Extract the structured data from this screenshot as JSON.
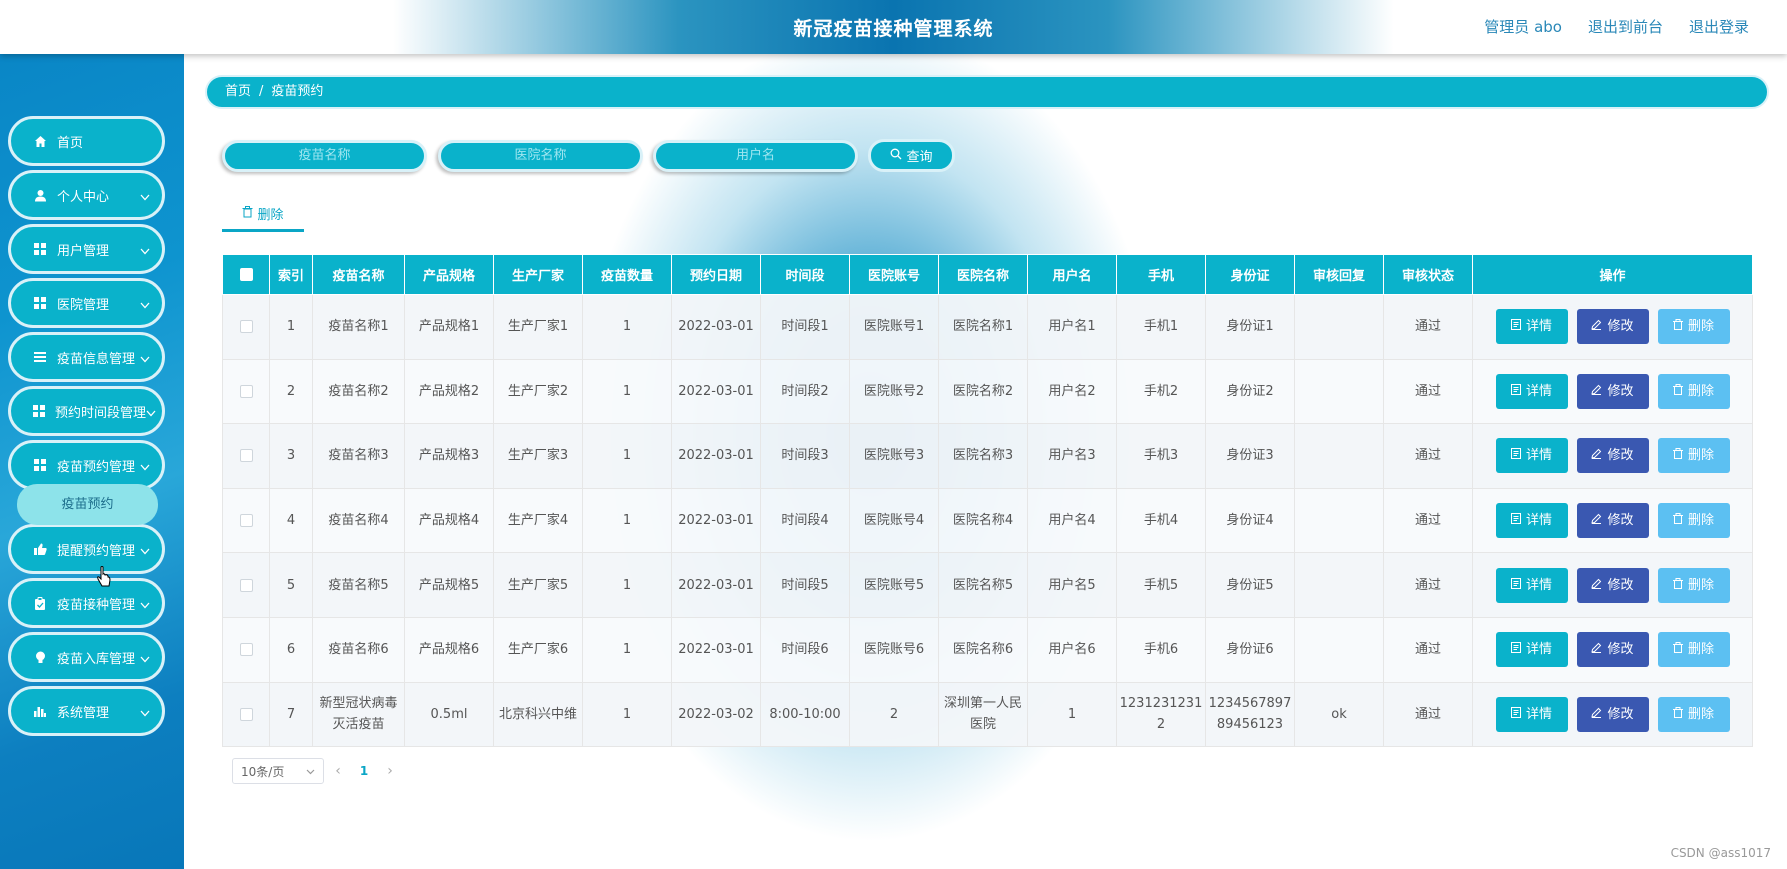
{
  "header": {
    "title": "新冠疫苗接种管理系统",
    "admin_label": "管理员 abo",
    "to_front_label": "退出到前台",
    "logout_label": "退出登录"
  },
  "sidebar": {
    "items": [
      {
        "label": "首页",
        "icon": "home-icon"
      },
      {
        "label": "个人中心",
        "icon": "user-icon"
      },
      {
        "label": "用户管理",
        "icon": "grid-icon"
      },
      {
        "label": "医院管理",
        "icon": "grid-icon"
      },
      {
        "label": "疫苗信息管理",
        "icon": "list-icon"
      },
      {
        "label": "预约时间段管理",
        "icon": "grid-icon"
      },
      {
        "label": "疫苗预约管理",
        "icon": "grid-icon"
      },
      {
        "label": "提醒预约管理",
        "icon": "thumb-icon"
      },
      {
        "label": "疫苗接种管理",
        "icon": "clipboard-icon"
      },
      {
        "label": "疫苗入库管理",
        "icon": "bulb-icon"
      },
      {
        "label": "系统管理",
        "icon": "chart-icon"
      }
    ],
    "active_submenu": "疫苗预约"
  },
  "breadcrumb": {
    "home": "首页",
    "separator": "/",
    "current": "疫苗预约"
  },
  "search": {
    "vaccine_placeholder": "疫苗名称",
    "hospital_placeholder": "医院名称",
    "user_placeholder": "用户名",
    "query_label": "查询"
  },
  "toolbar": {
    "delete_label": "删除"
  },
  "table": {
    "headers": [
      "索引",
      "疫苗名称",
      "产品规格",
      "生产厂家",
      "疫苗数量",
      "预约日期",
      "时间段",
      "医院账号",
      "医院名称",
      "用户名",
      "手机",
      "身份证",
      "审核回复",
      "审核状态",
      "操作"
    ],
    "rows": [
      [
        "1",
        "疫苗名称1",
        "产品规格1",
        "生产厂家1",
        "1",
        "2022-03-01",
        "时间段1",
        "医院账号1",
        "医院名称1",
        "用户名1",
        "手机1",
        "身份证1",
        "",
        "通过"
      ],
      [
        "2",
        "疫苗名称2",
        "产品规格2",
        "生产厂家2",
        "1",
        "2022-03-01",
        "时间段2",
        "医院账号2",
        "医院名称2",
        "用户名2",
        "手机2",
        "身份证2",
        "",
        "通过"
      ],
      [
        "3",
        "疫苗名称3",
        "产品规格3",
        "生产厂家3",
        "1",
        "2022-03-01",
        "时间段3",
        "医院账号3",
        "医院名称3",
        "用户名3",
        "手机3",
        "身份证3",
        "",
        "通过"
      ],
      [
        "4",
        "疫苗名称4",
        "产品规格4",
        "生产厂家4",
        "1",
        "2022-03-01",
        "时间段4",
        "医院账号4",
        "医院名称4",
        "用户名4",
        "手机4",
        "身份证4",
        "",
        "通过"
      ],
      [
        "5",
        "疫苗名称5",
        "产品规格5",
        "生产厂家5",
        "1",
        "2022-03-01",
        "时间段5",
        "医院账号5",
        "医院名称5",
        "用户名5",
        "手机5",
        "身份证5",
        "",
        "通过"
      ],
      [
        "6",
        "疫苗名称6",
        "产品规格6",
        "生产厂家6",
        "1",
        "2022-03-01",
        "时间段6",
        "医院账号6",
        "医院名称6",
        "用户名6",
        "手机6",
        "身份证6",
        "",
        "通过"
      ],
      [
        "7",
        "新型冠状病毒灭活疫苗",
        "0.5ml",
        "北京科兴中维",
        "1",
        "2022-03-02",
        "8:00-10:00",
        "2",
        "深圳第一人民医院",
        "1",
        "12312312312",
        "123456789789456123",
        "ok",
        "通过"
      ]
    ],
    "actions": {
      "detail_label": "详情",
      "edit_label": "修改",
      "delete_label": "删除"
    }
  },
  "pagination": {
    "page_size_label": "10条/页",
    "current_page": "1"
  },
  "watermark": "CSDN @ass1017",
  "colors": {
    "accent": "#0ab2cb",
    "edit": "#3a58b1",
    "delete": "#5cc0f2",
    "sidebar": "#0e94cf"
  }
}
